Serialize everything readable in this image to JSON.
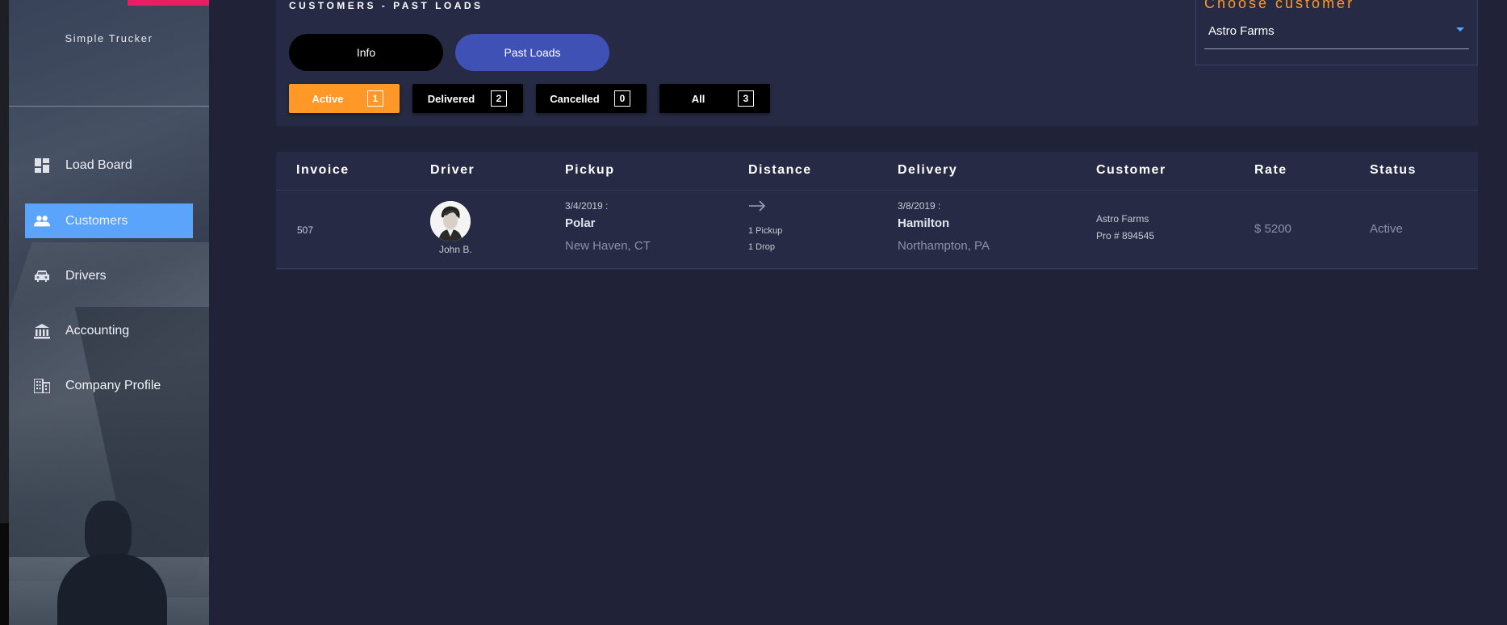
{
  "app": {
    "brand": "Simple Trucker"
  },
  "sidebar": {
    "items": [
      {
        "label": "Load Board",
        "icon": "dashboard-icon"
      },
      {
        "label": "Customers",
        "icon": "people-icon"
      },
      {
        "label": "Drivers",
        "icon": "car-icon"
      },
      {
        "label": "Accounting",
        "icon": "bank-icon"
      },
      {
        "label": "Company Profile",
        "icon": "building-icon"
      }
    ],
    "active_index": 1
  },
  "page": {
    "title": "CUSTOMERS - PAST LOADS",
    "tabs": [
      {
        "label": "Info"
      },
      {
        "label": "Past Loads"
      }
    ],
    "active_tab": 1
  },
  "filters": [
    {
      "label": "Active",
      "count": "1"
    },
    {
      "label": "Delivered",
      "count": "2"
    },
    {
      "label": "Cancelled",
      "count": "0"
    },
    {
      "label": "All",
      "count": "3"
    }
  ],
  "active_filter": 0,
  "customer_picker": {
    "label": "Choose customer",
    "value": "Astro Farms"
  },
  "table": {
    "columns": [
      "Invoice",
      "Driver",
      "Pickup",
      "Distance",
      "Delivery",
      "Customer",
      "Rate",
      "Status"
    ],
    "rows": [
      {
        "invoice": "507",
        "driver": "John B.",
        "pickup": {
          "date": "3/4/2019 :",
          "city": "Polar",
          "address": "New Haven, CT"
        },
        "distance": {
          "pickups": "1 Pickup",
          "drops": "1 Drop"
        },
        "delivery": {
          "date": "3/8/2019 :",
          "city": "Hamilton",
          "address": "Northampton, PA"
        },
        "customer": {
          "name": "Astro Farms",
          "pro": "Pro # 894545"
        },
        "rate": "$ 5200",
        "status": "Active"
      }
    ]
  },
  "colors": {
    "background": "#202337",
    "panel": "#262a44",
    "accent_orange": "#ff9826",
    "accent_blue": "#5aa4fb",
    "tab_active": "#3f51b5",
    "logo_pink": "#e91e63"
  }
}
